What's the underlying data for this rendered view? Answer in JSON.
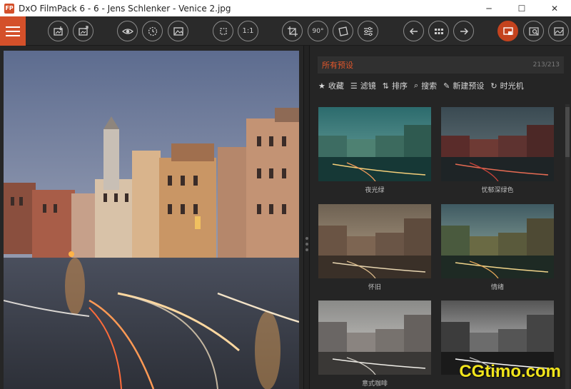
{
  "window": {
    "logo": "FP",
    "title": "DxO FilmPack 6 - 6 - Jens Schlenker - Venice 2.jpg",
    "minimize_icon": "─",
    "maximize_icon": "☐",
    "close_icon": "✕"
  },
  "toolbar": {
    "menu_icon": "hamburger-icon",
    "zoom_fit_label": "",
    "zoom_1to1_label": "1:1",
    "rotate_label": "90°",
    "buttons": [
      "import-image-icon",
      "export-image-icon",
      "preview-eye-icon",
      "compare-icon",
      "gallery-icon",
      "zoom-fit-icon",
      "zoom-1to1-icon",
      "crop-icon",
      "rotate-icon",
      "straighten-icon",
      "adjust-sliders-icon",
      "previous-icon",
      "grid-view-icon",
      "next-icon",
      "presets-panel-icon",
      "loupe-icon",
      "histogram-icon"
    ]
  },
  "panel": {
    "title": "所有预设",
    "count": "213/213",
    "filters": [
      {
        "icon": "star-icon",
        "glyph": "★",
        "label": "收藏"
      },
      {
        "icon": "list-icon",
        "glyph": "☰",
        "label": "滤镜"
      },
      {
        "icon": "sort-icon",
        "glyph": "⇅",
        "label": "排序"
      },
      {
        "icon": "search-icon",
        "glyph": "⌕",
        "label": "搜索"
      },
      {
        "icon": "new-preset-icon",
        "glyph": "✎",
        "label": "新建预设"
      },
      {
        "icon": "time-machine-icon",
        "glyph": "↻",
        "label": "时光机"
      }
    ],
    "presets": [
      {
        "label": "夜光绿"
      },
      {
        "label": "忧郁深绿色"
      },
      {
        "label": "怀旧"
      },
      {
        "label": "情绪"
      },
      {
        "label": "意式咖啡"
      },
      {
        "label": ""
      }
    ]
  },
  "watermark": "CGtimo.com",
  "colors": {
    "accent": "#d4502a",
    "panel_title": "#e0562b",
    "watermark": "#f1e51c"
  }
}
